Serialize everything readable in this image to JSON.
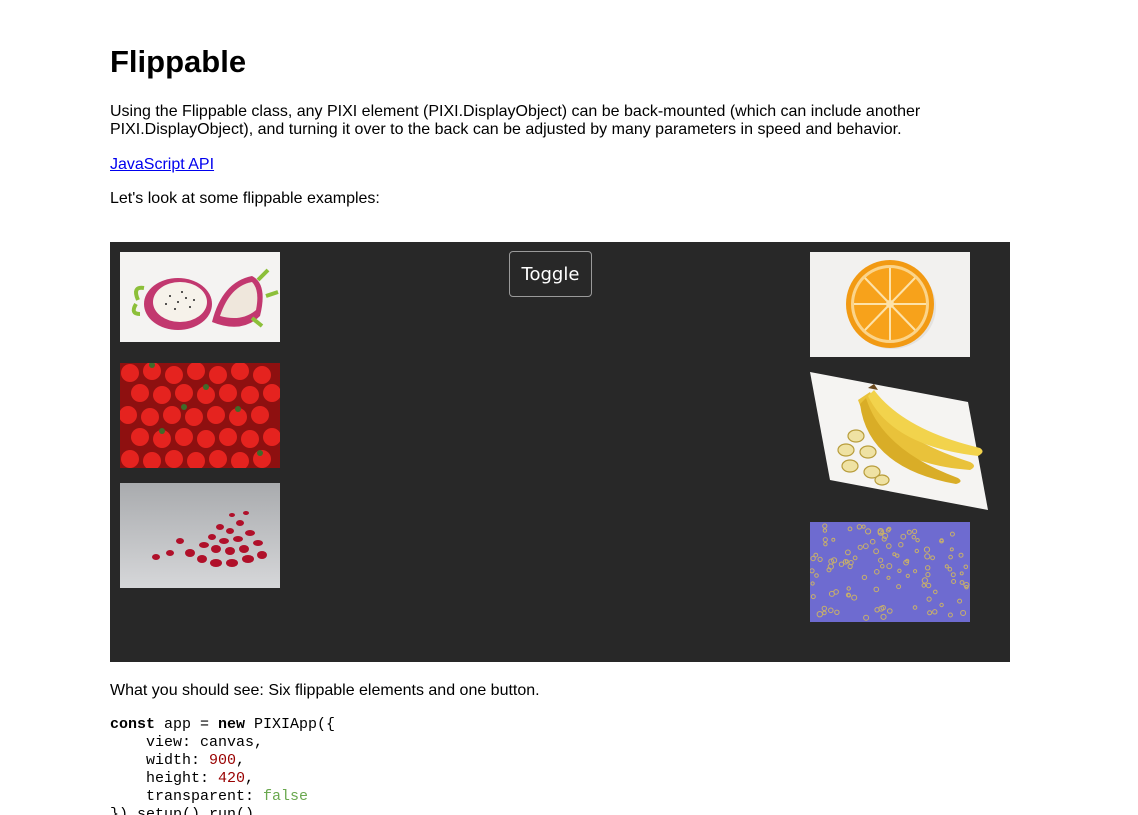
{
  "header": {
    "title": "Flippable"
  },
  "intro": {
    "text": "Using the Flippable class, any PIXI element (PIXI.DisplayObject) can be back-mounted (which can include another PIXI.DisplayObject), and turning it over to the back can be adjusted by many parameters in speed and behavior."
  },
  "links": {
    "api_label": "JavaScript API"
  },
  "examples_intro": "Let's look at some flippable examples:",
  "stage": {
    "background": "#282828",
    "toggle_label": "Toggle",
    "cards": [
      {
        "name": "dragon-fruit",
        "image": "dragon-fruit-photo"
      },
      {
        "name": "strawberries",
        "image": "strawberries-photo"
      },
      {
        "name": "pomegranate",
        "image": "pomegranate-seeds-photo"
      },
      {
        "name": "orange",
        "image": "orange-half-photo"
      },
      {
        "name": "banana",
        "image": "bananas-photo"
      },
      {
        "name": "bubbles",
        "image": "bubble-pattern",
        "color": "#6e6bd0"
      }
    ]
  },
  "expectation": "What you should see: Six flippable elements and one button.",
  "code": {
    "line1_kw1": "const",
    "line1_mid": " app = ",
    "line1_kw2": "new",
    "line1_end": " PIXIApp({",
    "line2": "    view: canvas,",
    "line3_key": "    width: ",
    "line3_val": "900",
    "line3_end": ",",
    "line4_key": "    height: ",
    "line4_val": "420",
    "line4_end": ",",
    "line5_key": "    transparent: ",
    "line5_val": "false",
    "line6": "}).setup().run()"
  }
}
